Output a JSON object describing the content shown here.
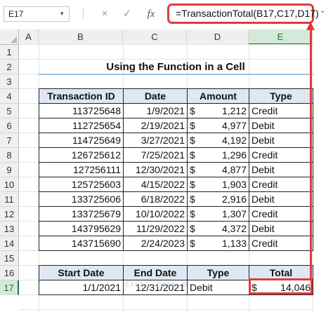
{
  "formula_bar": {
    "name_box": "E17",
    "formula": "=TransactionTotal(B17,C17,D17)",
    "cancel_icon": "×",
    "enter_icon": "✓",
    "fx_icon": "fx"
  },
  "columns": [
    "A",
    "B",
    "C",
    "D",
    "E"
  ],
  "rows": [
    "1",
    "2",
    "3",
    "4",
    "5",
    "6",
    "7",
    "8",
    "9",
    "10",
    "11",
    "12",
    "13",
    "14",
    "15",
    "16",
    "17"
  ],
  "title": "Using the Function in a Cell",
  "transactions": {
    "headers": [
      "Transaction ID",
      "Date",
      "Amount",
      "Type"
    ],
    "currency_symbol": "$",
    "rows": [
      {
        "id": "113725648",
        "date": "1/9/2021",
        "amount": "1,212",
        "type": "Credit"
      },
      {
        "id": "112725654",
        "date": "2/19/2021",
        "amount": "4,977",
        "type": "Debit"
      },
      {
        "id": "114725649",
        "date": "3/27/2021",
        "amount": "4,192",
        "type": "Debit"
      },
      {
        "id": "126725612",
        "date": "7/25/2021",
        "amount": "1,296",
        "type": "Credit"
      },
      {
        "id": "127256111",
        "date": "12/30/2021",
        "amount": "4,877",
        "type": "Debit"
      },
      {
        "id": "125725603",
        "date": "4/15/2022",
        "amount": "1,903",
        "type": "Credit"
      },
      {
        "id": "133725606",
        "date": "6/18/2022",
        "amount": "2,916",
        "type": "Debit"
      },
      {
        "id": "133725679",
        "date": "10/10/2022",
        "amount": "1,307",
        "type": "Credit"
      },
      {
        "id": "143795629",
        "date": "11/29/2022",
        "amount": "4,372",
        "type": "Debit"
      },
      {
        "id": "143715690",
        "date": "2/24/2023",
        "amount": "1,133",
        "type": "Credit"
      }
    ]
  },
  "summary": {
    "headers": [
      "Start Date",
      "End Date",
      "Type",
      "Total"
    ],
    "start_date": "1/1/2021",
    "end_date": "12/31/2021",
    "type": "Debit",
    "currency_symbol": "$",
    "total": "14,046"
  },
  "watermark": "EXCEL · DATA · BI",
  "colors": {
    "highlight": "#e03a3a",
    "header_fill": "#dde8f3",
    "selection": "#217346"
  }
}
